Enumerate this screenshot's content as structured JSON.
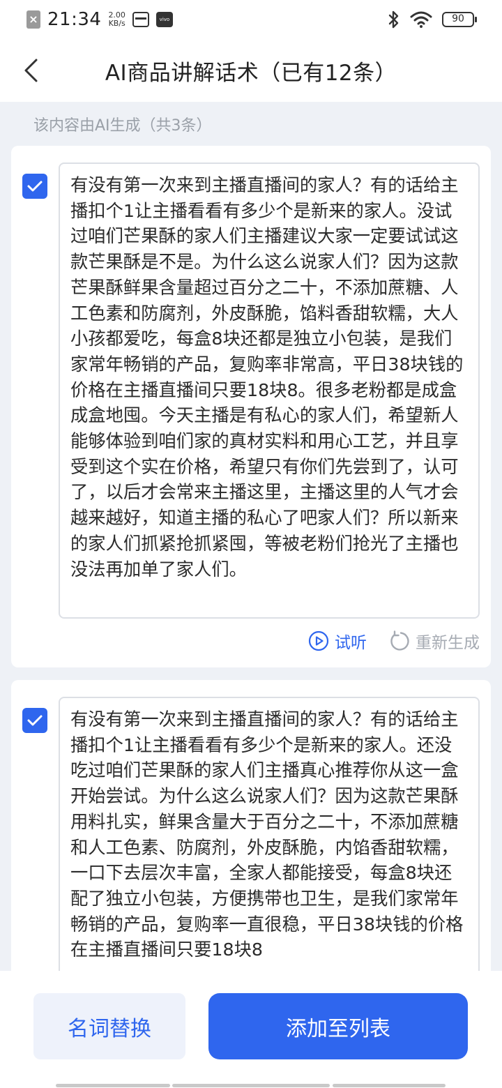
{
  "status_bar": {
    "time": "21:34",
    "speed_value": "2.00",
    "speed_unit": "KB/s",
    "battery": "90",
    "vivo_badge": "vivo"
  },
  "header": {
    "title": "AI商品讲解话术（已有12条）",
    "back_icon": "chevron-left-icon"
  },
  "subtitle": "该内容由AI生成（共3条）",
  "scripts": [
    {
      "checked": true,
      "text": "有没有第一次来到主播直播间的家人？有的话给主播扣个1让主播看看有多少个是新来的家人。没试过咱们芒果酥的家人们主播建议大家一定要试试这款芒果酥是不是。为什么这么说家人们？因为这款芒果酥鲜果含量超过百分之二十，不添加蔗糖、人工色素和防腐剂，外皮酥脆，馅料香甜软糯，大人小孩都爱吃，每盒8块还都是独立小包装，是我们家常年畅销的产品，复购率非常高，平日38块钱的价格在主播直播间只要18块8。很多老粉都是成盒成盒地囤。今天主播是有私心的家人们，希望新人能够体验到咱们家的真材实料和用心工艺，并且享受到这个实在价格，希望只有你们先尝到了，认可了，以后才会常来主播这里，主播这里的人气才会越来越好，知道主播的私心了吧家人们？所以新来的家人们抓紧抢抓紧囤，等被老粉们抢光了主播也没法再加单了家人们。",
      "listen_label": "试听",
      "regenerate_label": "重新生成"
    },
    {
      "checked": true,
      "text": "有没有第一次来到主播直播间的家人？有的话给主播扣个1让主播看看有多少个是新来的家人。还没吃过咱们芒果酥的家人们主播真心推荐你从这一盒开始尝试。为什么这么说家人们？因为这款芒果酥用料扎实，鲜果含量大于百分之二十，不添加蔗糖和人工色素、防腐剂，外皮酥脆，内馅香甜软糯，一口下去层次丰富，全家人都能接受，每盒8块还配了独立小包装，方便携带也卫生，是我们家常年畅销的产品，复购率一直很稳，平日38块钱的价格在主播直播间只要18块8"
    }
  ],
  "bottom": {
    "replace_label": "名词替换",
    "add_label": "添加至列表"
  },
  "colors": {
    "accent": "#2f66ee",
    "muted": "#a6abb3",
    "background": "#eef1f6"
  }
}
